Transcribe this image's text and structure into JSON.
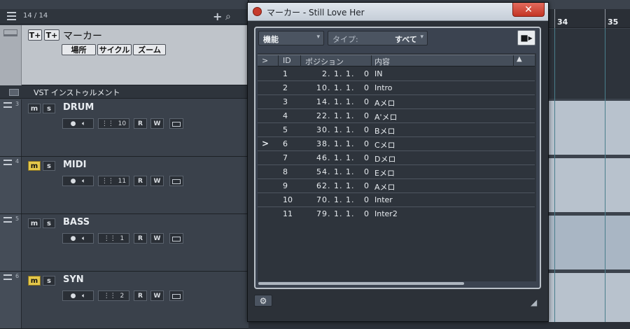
{
  "tracklist": {
    "count": "14 / 14",
    "add_symbol": "+",
    "search_symbol": "⌕"
  },
  "marker_track": {
    "title": "マーカー",
    "buttons": [
      "場所",
      "サイクル",
      "ズーム"
    ],
    "add_marker_label": "T+",
    "add_cycle_label": "T+"
  },
  "folder_track": {
    "name": "VST インストゥルメント"
  },
  "tracks": [
    {
      "num": "3",
      "name": "DRUM",
      "m": "m",
      "s": "s",
      "m_on": false,
      "channel": "10",
      "r": "R",
      "w": "W"
    },
    {
      "num": "4",
      "name": "MIDI",
      "m": "m",
      "s": "s",
      "m_on": true,
      "channel": "11",
      "r": "R",
      "w": "W"
    },
    {
      "num": "5",
      "name": "BASS",
      "m": "m",
      "s": "s",
      "m_on": false,
      "channel": "1",
      "r": "R",
      "w": "W"
    },
    {
      "num": "6",
      "name": "SYN",
      "m": "m",
      "s": "s",
      "m_on": true,
      "channel": "2",
      "r": "R",
      "w": "W"
    }
  ],
  "ruler": {
    "bars": [
      "34",
      "35"
    ]
  },
  "marker_window": {
    "title": "マーカー - Still Love Her",
    "close": "✕",
    "filter": "機能",
    "type_label": "タイプ:",
    "type_value": "すべて",
    "columns": {
      "cursor": ">",
      "id": "ID",
      "position": "ポジション",
      "description": "内容"
    },
    "sort_arrow": "▲",
    "markers": [
      {
        "id": "1",
        "position": "2. 1. 1.   0",
        "description": "IN",
        "current": false
      },
      {
        "id": "2",
        "position": "10. 1. 1.   0",
        "description": "Intro",
        "current": false
      },
      {
        "id": "3",
        "position": "14. 1. 1.   0",
        "description": "Aメロ",
        "current": false
      },
      {
        "id": "4",
        "position": "22. 1. 1.   0",
        "description": "A'メロ",
        "current": false
      },
      {
        "id": "5",
        "position": "30. 1. 1.   0",
        "description": "Bメロ",
        "current": false
      },
      {
        "id": "6",
        "position": "38. 1. 1.   0",
        "description": "Cメロ",
        "current": true
      },
      {
        "id": "7",
        "position": "46. 1. 1.   0",
        "description": "Dメロ",
        "current": false
      },
      {
        "id": "8",
        "position": "54. 1. 1.   0",
        "description": "Eメロ",
        "current": false
      },
      {
        "id": "9",
        "position": "62. 1. 1.   0",
        "description": "Aメロ",
        "current": false
      },
      {
        "id": "10",
        "position": "70. 1. 1.   0",
        "description": "Inter",
        "current": false
      },
      {
        "id": "11",
        "position": "79. 1. 1.   0",
        "description": "Inter2",
        "current": false
      }
    ],
    "current_symbol": ">",
    "settings_icon": "⚙",
    "grip": "◢"
  },
  "colors": {
    "accent_yellow": "#e5c84a",
    "close_red": "#c33524",
    "marker_track_bg": "#bfc4ca"
  }
}
